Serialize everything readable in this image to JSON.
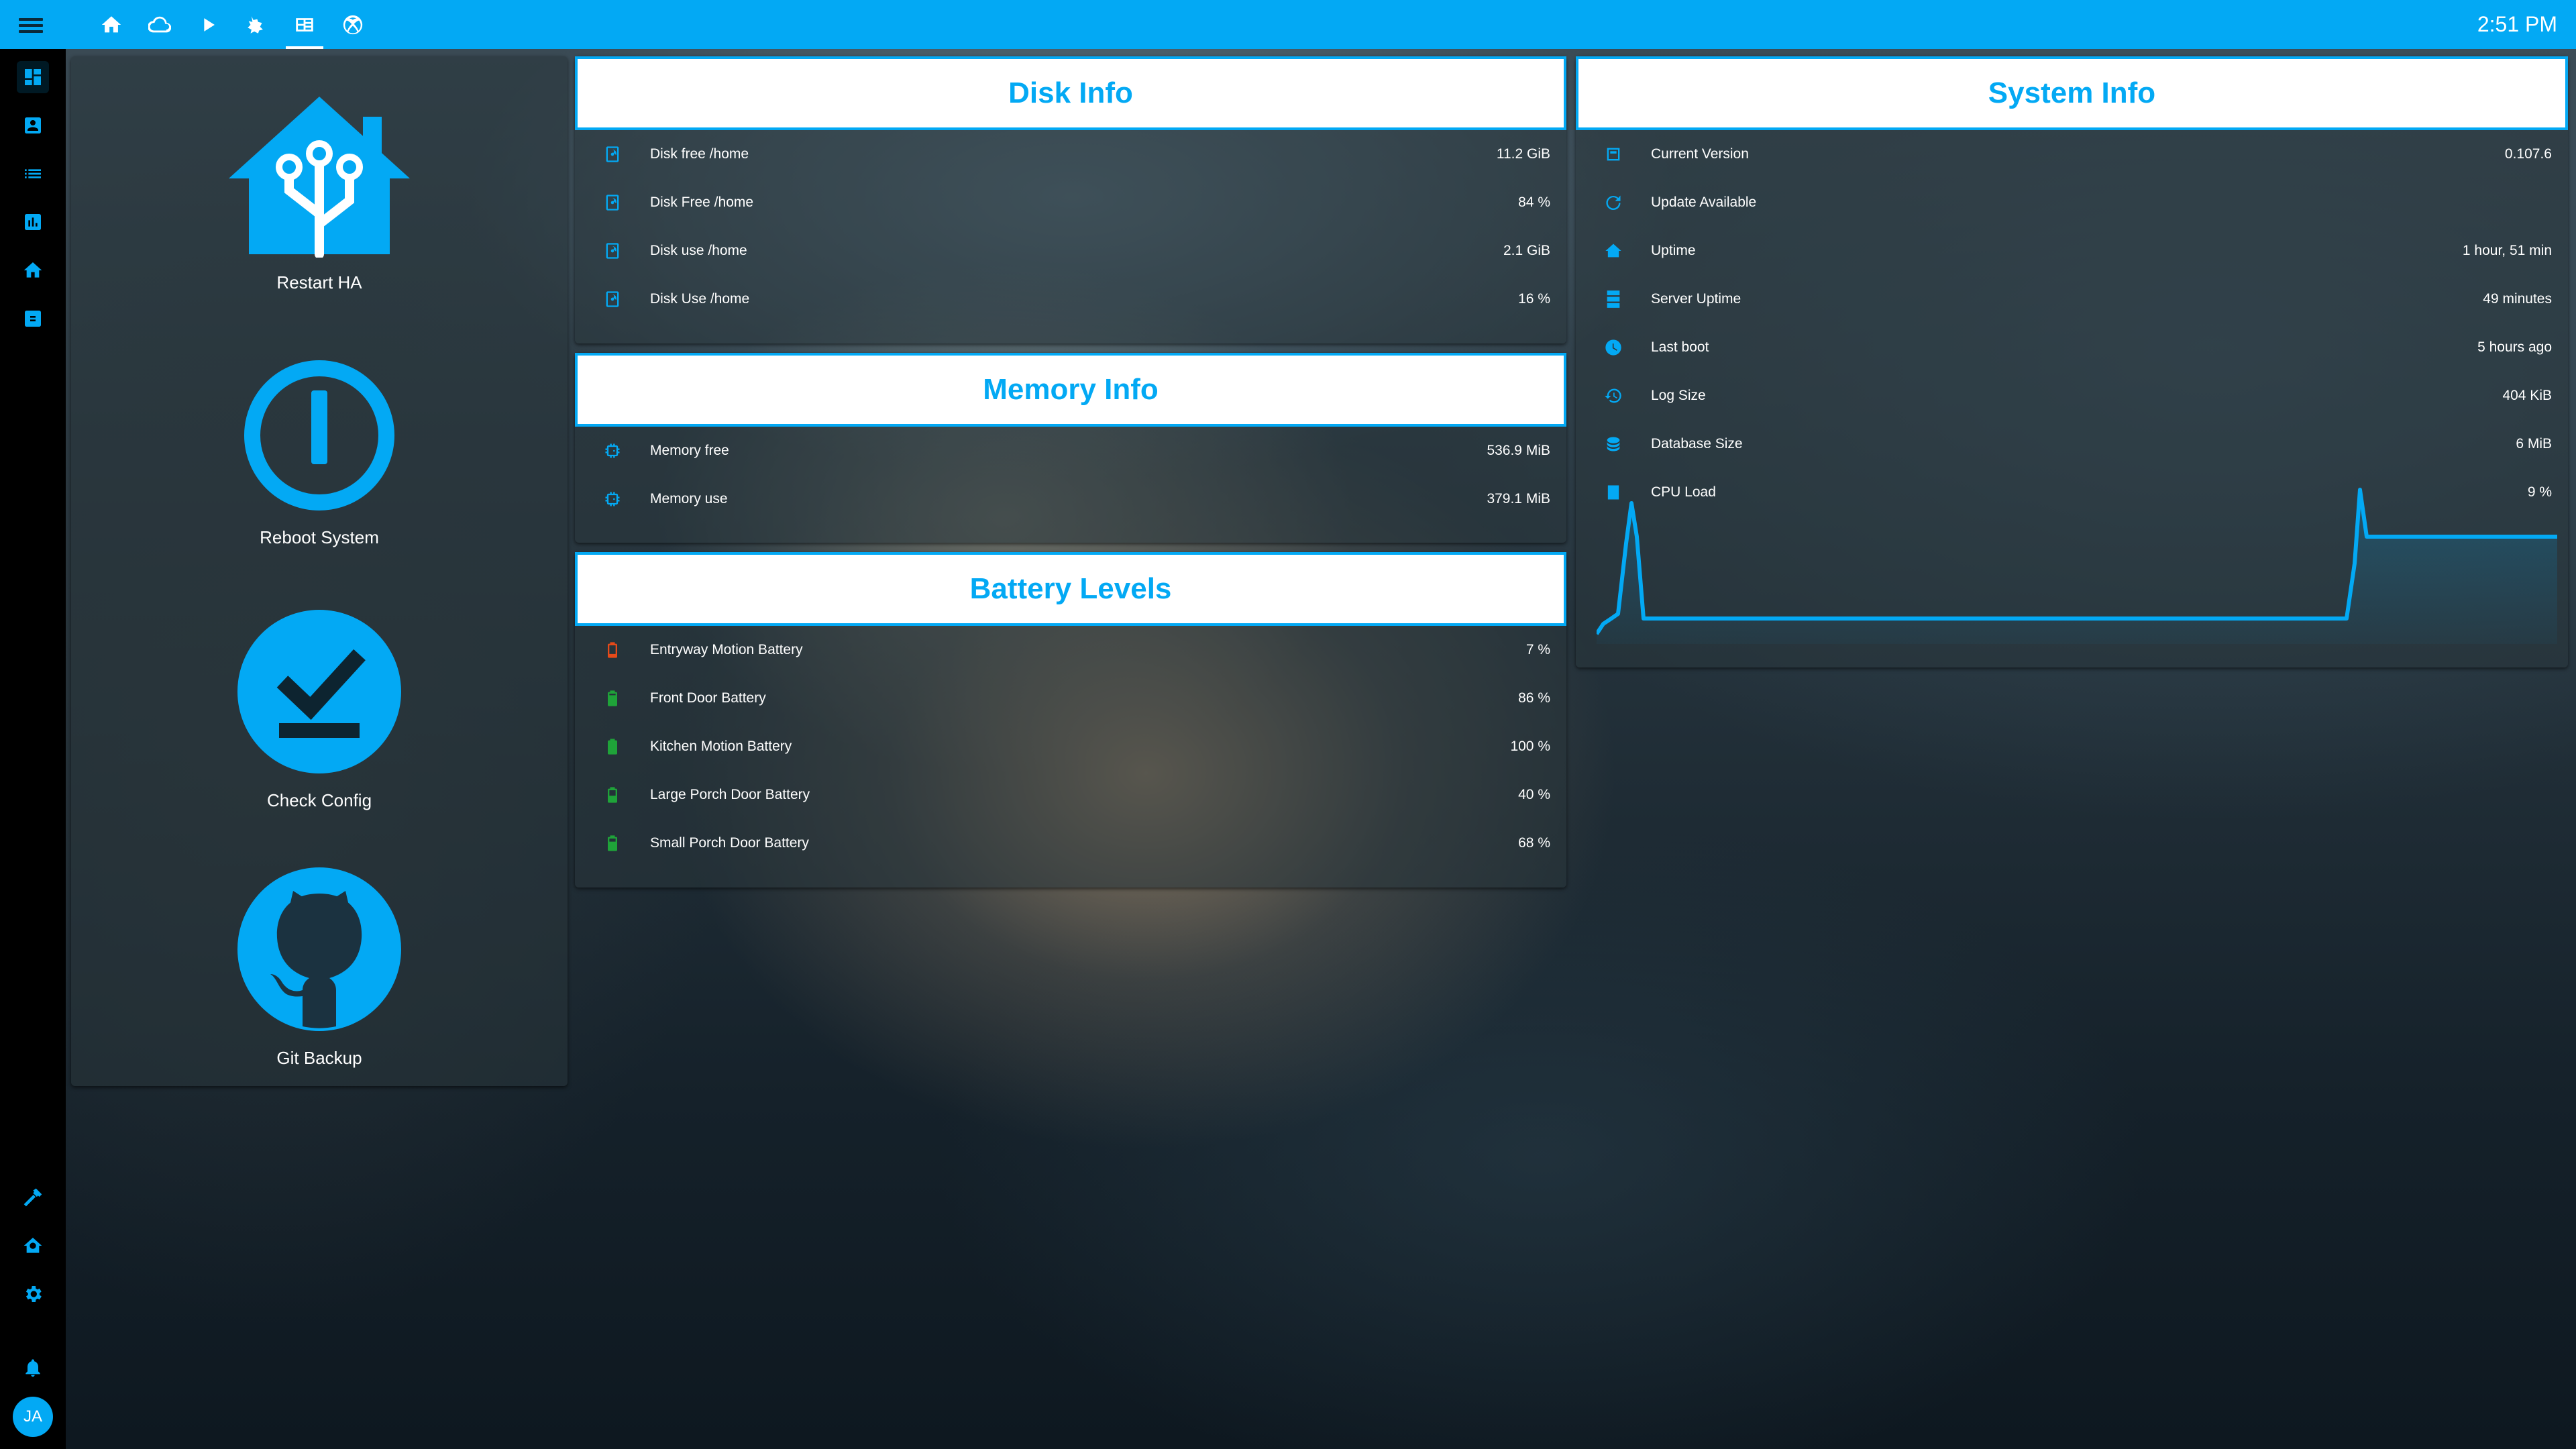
{
  "topbar": {
    "time": "2:51 PM",
    "tabs": [
      {
        "icon": "home-icon"
      },
      {
        "icon": "cloud-icon"
      },
      {
        "icon": "play-icon"
      },
      {
        "icon": "robot-vacuum-icon"
      },
      {
        "icon": "server-icon"
      },
      {
        "icon": "xbox-icon"
      }
    ]
  },
  "sidebar": {
    "items": [
      {
        "icon": "dashboard-icon"
      },
      {
        "icon": "account-box-icon"
      },
      {
        "icon": "list-icon"
      },
      {
        "icon": "chart-icon"
      },
      {
        "icon": "home-icon"
      },
      {
        "icon": "calendar-icon"
      }
    ],
    "bottom": [
      {
        "icon": "hammer-icon"
      },
      {
        "icon": "home-settings-icon"
      },
      {
        "icon": "gear-icon"
      },
      {
        "icon": "bell-icon"
      }
    ],
    "avatar": "JA"
  },
  "buttons": [
    {
      "label": "Restart HA",
      "icon": "home-assistant-icon"
    },
    {
      "label": "Reboot System",
      "icon": "power-icon"
    },
    {
      "label": "Check Config",
      "icon": "check-circle-icon"
    },
    {
      "label": "Git Backup",
      "icon": "github-icon"
    }
  ],
  "disk": {
    "title": "Disk Info",
    "rows": [
      {
        "label": "Disk free /home",
        "value": "11.2 GiB",
        "icon": "harddisk-icon"
      },
      {
        "label": "Disk Free /home",
        "value": "84 %",
        "icon": "harddisk-icon"
      },
      {
        "label": "Disk use /home",
        "value": "2.1 GiB",
        "icon": "harddisk-icon"
      },
      {
        "label": "Disk Use /home",
        "value": "16 %",
        "icon": "harddisk-icon"
      }
    ]
  },
  "memory": {
    "title": "Memory Info",
    "rows": [
      {
        "label": "Memory free",
        "value": "536.9 MiB",
        "icon": "memory-icon"
      },
      {
        "label": "Memory use",
        "value": "379.1 MiB",
        "icon": "memory-icon"
      }
    ]
  },
  "battery": {
    "title": "Battery Levels",
    "rows": [
      {
        "label": "Entryway Motion Battery",
        "value": "7 %",
        "icon": "battery-low-icon",
        "color": "#e64a19"
      },
      {
        "label": "Front Door Battery",
        "value": "86 %",
        "icon": "battery-icon",
        "color": "#1fa339"
      },
      {
        "label": "Kitchen Motion Battery",
        "value": "100 %",
        "icon": "battery-full-icon",
        "color": "#1fa339"
      },
      {
        "label": "Large Porch Door Battery",
        "value": "40 %",
        "icon": "battery-medium-icon",
        "color": "#1fa339"
      },
      {
        "label": "Small Porch Door Battery",
        "value": "68 %",
        "icon": "battery-icon",
        "color": "#1fa339"
      }
    ]
  },
  "system": {
    "title": "System Info",
    "rows": [
      {
        "label": "Current Version",
        "value": "0.107.6",
        "icon": "package-icon"
      },
      {
        "label": "Update Available",
        "value": "",
        "icon": "update-icon"
      },
      {
        "label": "Uptime",
        "value": "1 hour, 51 min",
        "icon": "home-assistant-icon"
      },
      {
        "label": "Server Uptime",
        "value": "49 minutes",
        "icon": "server-icon"
      },
      {
        "label": "Last boot",
        "value": "5 hours ago",
        "icon": "clock-icon"
      },
      {
        "label": "Log Size",
        "value": "404 KiB",
        "icon": "history-icon"
      },
      {
        "label": "Database Size",
        "value": "6 MiB",
        "icon": "database-icon"
      },
      {
        "label": "CPU Load",
        "value": "9 %",
        "icon": "cpu-icon"
      }
    ]
  },
  "colors": {
    "accent": "#03a9f4",
    "battery_low": "#e64a19",
    "battery_ok": "#1fa339"
  }
}
